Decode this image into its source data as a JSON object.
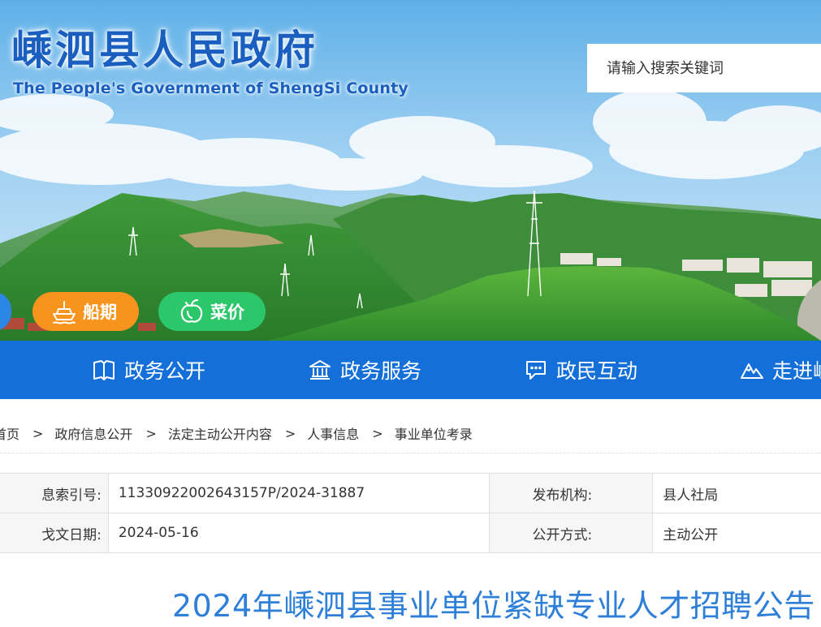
{
  "site": {
    "title": "嵊泗县人民政府",
    "subtitle": "The People's Government of ShengSi County"
  },
  "search": {
    "placeholder": "请输入搜索关键词"
  },
  "quick_links": [
    {
      "label": "船期",
      "icon": "ship-icon",
      "color": "#f7941d"
    },
    {
      "label": "菜价",
      "icon": "vegetable-icon",
      "color": "#2cc76a"
    }
  ],
  "nav": {
    "items": [
      {
        "label": "政务公开",
        "icon": "book-icon"
      },
      {
        "label": "政务服务",
        "icon": "government-building-icon"
      },
      {
        "label": "政民互动",
        "icon": "chat-icon"
      },
      {
        "label": "走进嵊",
        "icon": "mountain-icon"
      }
    ],
    "color": "#1470d8"
  },
  "breadcrumb": {
    "items": [
      "首页",
      "政府信息公开",
      "法定主动公开内容",
      "人事信息",
      "事业单位考录"
    ],
    "separator": ">"
  },
  "info": {
    "index_label": "息索引号:",
    "index_value": "11330922002643157P/2024-31887",
    "publisher_label": "发布机构:",
    "publisher_value": "县人社局",
    "date_label": "戈文日期:",
    "date_value": "2024-05-16",
    "method_label": "公开方式:",
    "method_value": "主动公开"
  },
  "article": {
    "title": "2024年嵊泗县事业单位紧缺专业人才招聘公告",
    "title_color": "#2d7fd8"
  }
}
